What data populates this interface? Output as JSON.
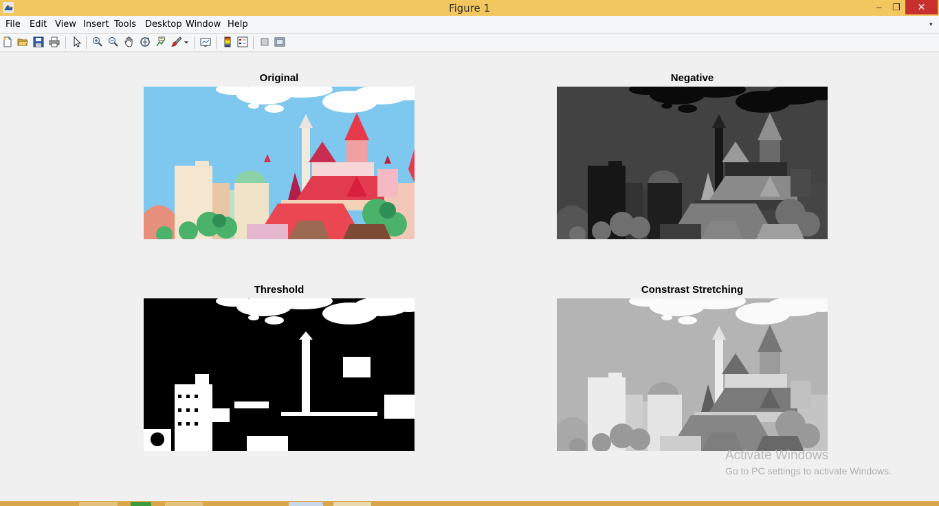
{
  "window": {
    "title": "Figure 1",
    "min_glyph": "‒",
    "restore_glyph": "❐",
    "close_glyph": "✕"
  },
  "menu": [
    "File",
    "Edit",
    "View",
    "Insert",
    "Tools",
    "Desktop",
    "Window",
    "Help"
  ],
  "toolbar_icons": [
    "new-figure-icon",
    "open-file-icon",
    "save-icon",
    "print-icon",
    "edit-plot-pointer-icon",
    "zoom-in-icon",
    "zoom-out-icon",
    "pan-hand-icon",
    "rotate-3d-icon",
    "data-cursor-icon",
    "brush-icon",
    "link-plot-icon",
    "insert-colorbar-icon",
    "insert-legend-icon",
    "hide-plot-tools-icon",
    "show-plot-tools-icon"
  ],
  "axes": [
    {
      "title": "Original"
    },
    {
      "title": "Negative"
    },
    {
      "title": "Threshold"
    },
    {
      "title": "Constrast Stretching"
    }
  ],
  "watermark": {
    "line1": "Activate Windows",
    "line2": "Go to PC settings to activate Windows."
  },
  "colors": {
    "titlebar": "#f2c760",
    "close_button": "#c7302c",
    "sky": "#7ec8ef",
    "taskbar": "#d9a74a"
  }
}
